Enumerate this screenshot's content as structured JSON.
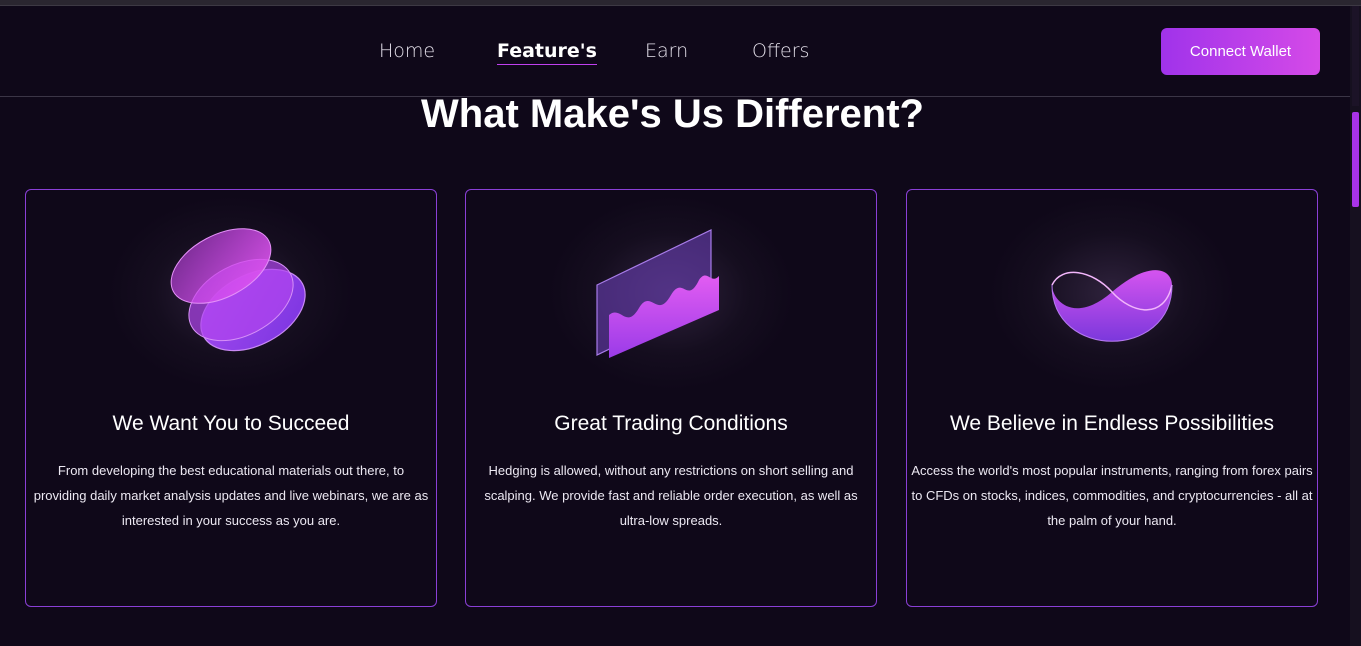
{
  "nav": {
    "items": [
      {
        "label": "Home"
      },
      {
        "label": "Feature's",
        "active": true
      },
      {
        "label": "Earn"
      },
      {
        "label": "Offers"
      }
    ],
    "connect_wallet": "Connect Wallet"
  },
  "section": {
    "heading": "What Make's Us Different?"
  },
  "cards": [
    {
      "icon": "stacked-discs-icon",
      "title": "We Want You to Succeed",
      "description": "From developing the best educational materials out there, to providing daily market analysis updates and live webinars, we are as interested in your success as you are."
    },
    {
      "icon": "trading-chart-icon",
      "title": "Great Trading Conditions",
      "description": "Hedging is allowed, without any restrictions on short selling and scalping. We provide fast and reliable order execution, as well as ultra-low spreads."
    },
    {
      "icon": "infinity-bowl-icon",
      "title": "We Believe in Endless Possibilities",
      "description": "Access the world's most popular instruments, ranging from forex pairs to CFDs on stocks, indices, commodities, and cryptocurrencies - all at the palm of your hand."
    }
  ],
  "colors": {
    "background": "#0f0819",
    "accent": "#a033ea",
    "accent_end": "#d54ae8",
    "card_border": "#8a3fd6"
  }
}
